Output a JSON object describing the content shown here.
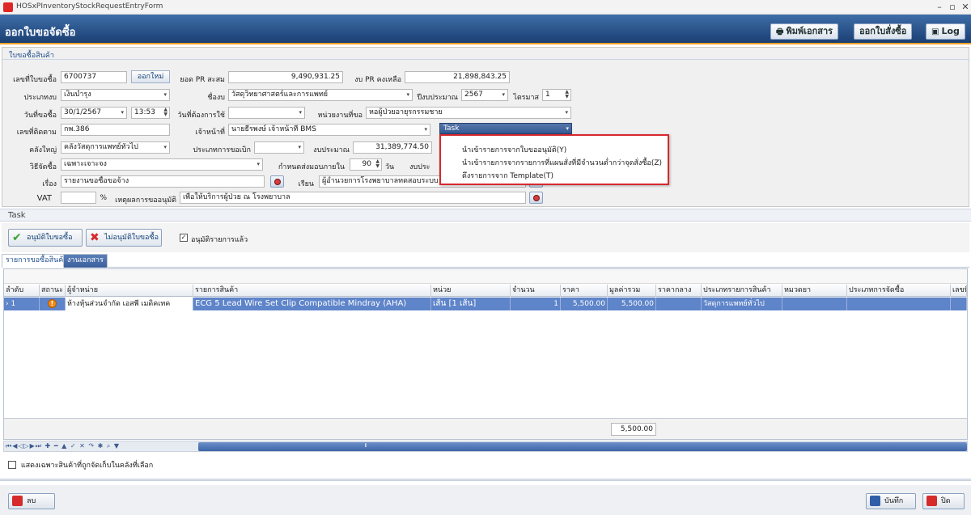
{
  "window": {
    "title": "HOSxPInventoryStockRequestEntryForm",
    "minimize": "–",
    "maximize": "▫",
    "close": "✕"
  },
  "header": {
    "title": "ออกใบขอจัดซื้อ",
    "print_label": "พิมพ์เอกสาร",
    "order_label": "ออกใบสั่งซื้อ",
    "log_label": "Log"
  },
  "section": {
    "caption": "ใบขอซื้อสินค้า"
  },
  "form": {
    "doc_no_label": "เลขที่ใบขอซื้อ",
    "doc_no": "6700737",
    "new_button": "ออกใหม่",
    "pr_total_label": "ยอด PR สะสม",
    "pr_total": "9,490,931.25",
    "pr_remain_label": "งบ PR คงเหลือ",
    "pr_remain": "21,898,843.25",
    "budget_type_label": "ประเภทงบ",
    "budget_type": "เงินบำรุง",
    "budget_name_label": "ชื่องบ",
    "budget_name": "วัสดุวิทยาศาสตร์และการแพทย์",
    "fiscal_year_label": "ปีงบประมาณ",
    "fiscal_year": "2567",
    "quarter_label": "ไตรมาส",
    "quarter": "1",
    "request_date_label": "วันที่ขอซื้อ",
    "request_date": "30/1/2567",
    "request_time": "13:53",
    "need_date_label": "วันที่ต้องการใช้",
    "need_date": "",
    "department_label": "หน่วยงานที่ขอ",
    "department": "หอผู้ป่วยอายุรกรรมชาย",
    "ref_no_label": "เลขที่ติดตาม",
    "ref_no": "กพ.386",
    "officer_label": "เจ้าหน้าที่",
    "officer": "นายธีรพงษ์ เจ้าหน้าที่ BMS",
    "warehouse_label": "คลังใหญ่",
    "warehouse": "คลังวัสดุการแพทย์ทั่วไป",
    "withdraw_type_label": "ประเภทการขอเบิก",
    "withdraw_type": "",
    "budget_amount_label": "งบประมาณ",
    "budget_amount": "31,389,774.50",
    "method_label": "วิธีจัดซื้อ",
    "method": "เฉพาะเจาะจง",
    "delivery_label": "กำหนดส่งมอบภายใน",
    "delivery_days": "90",
    "days_unit": "วัน",
    "budget2_label": "งบประ",
    "subject_label": "เรื่อง",
    "subject": "รายงานขอซื้อขอจ้าง",
    "to_label": "เรียน",
    "to": "ผู้อำนวยการโรงพยาบาลทดสอบระบบ",
    "vat_label": "VAT",
    "vat": "",
    "vat_unit": "%",
    "reason_label": "เหตุผลการขออนุมัติ",
    "reason": "เพื่อให้บริการผู้ป่วย ณ โรงพยาบาล"
  },
  "task_combo": {
    "label": "Task"
  },
  "task_menu": {
    "items": [
      "นำเข้ารายการจากใบขออนุมัติ(Y)",
      "นำเข้ารายการจากรายการที่แผนสั่งที่มีจำนวนต่ำกว่าจุดสั่งซื้อ(Z)",
      "ดึงรายการจาก Template(T)"
    ]
  },
  "task_section": {
    "caption": "Task"
  },
  "task_bar": {
    "approve": "อนุมัติใบขอซื้อ",
    "reject": "ไม่อนุมัติใบขอซื้อ",
    "approved_check": "อนุมัติรายการแล้ว"
  },
  "tabs": [
    {
      "label": "รายการขอซื้อสินค้า"
    },
    {
      "label": "งานเอกสาร"
    }
  ],
  "grid": {
    "columns": [
      "ลำดับ",
      "สถานะ",
      "ผู้จำหน่าย",
      "รายการสินค้า",
      "หน่วย",
      "จำนวน",
      "ราคา",
      "มูลค่ารวม",
      "ราคากลาง",
      "ประเภทรายการสินค้า",
      "หมวดยา",
      "ประเภทการจัดซื้อ",
      "เลขที่"
    ],
    "row": {
      "seq": "1",
      "vendor": "ห้างหุ้นส่วนจำกัด เอสพี เมดิคเทค",
      "item": "ECG 5 Lead Wire Set Clip Compatible Mindray (AHA)",
      "unit": "เส้น [1 เส้น]",
      "qty": "1",
      "price": "5,500.00",
      "total": "5,500.00",
      "median": "",
      "item_type": "วัสดุการแพทย์ทั่วไป",
      "drug_cat": "",
      "purchase_type": ""
    },
    "footer_total": "5,500.00"
  },
  "options": {
    "only_in_stock": "แสดงเฉพาะสินค้าที่ถูกจัดเก็บในคลังที่เลือก"
  },
  "footer": {
    "delete": "ลบ",
    "save": "บันทึก",
    "close": "ปิด"
  }
}
